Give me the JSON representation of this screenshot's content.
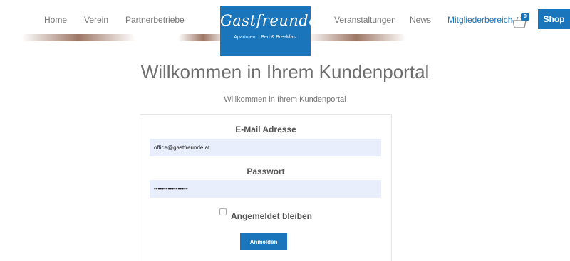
{
  "nav": {
    "home": "Home",
    "verein": "Verein",
    "partner": "Partnerbetriebe",
    "events": "Veranstaltungen",
    "news": "News",
    "members": "Mitgliederbereich"
  },
  "logo": {
    "brand": "Gastfreunde",
    "tagline": "Apartment | Bed & Breakfast"
  },
  "cart": {
    "icon": "shopping-cart-icon",
    "count": "0"
  },
  "shop": {
    "label": "Shop"
  },
  "page": {
    "title": "Willkommen in Ihrem Kundenportal",
    "subtitle": "Willkommen in Ihrem Kundenportal"
  },
  "login": {
    "email_label": "E-Mail Adresse",
    "email_value": "office@gastfreunde.at",
    "password_label": "Passwort",
    "password_value": "•••••••••••••••••",
    "remember_label": "Angemeldet bleiben",
    "submit_label": "Anmelden"
  },
  "colors": {
    "accent": "#1b75bb",
    "input_bg": "#e8eefb"
  }
}
